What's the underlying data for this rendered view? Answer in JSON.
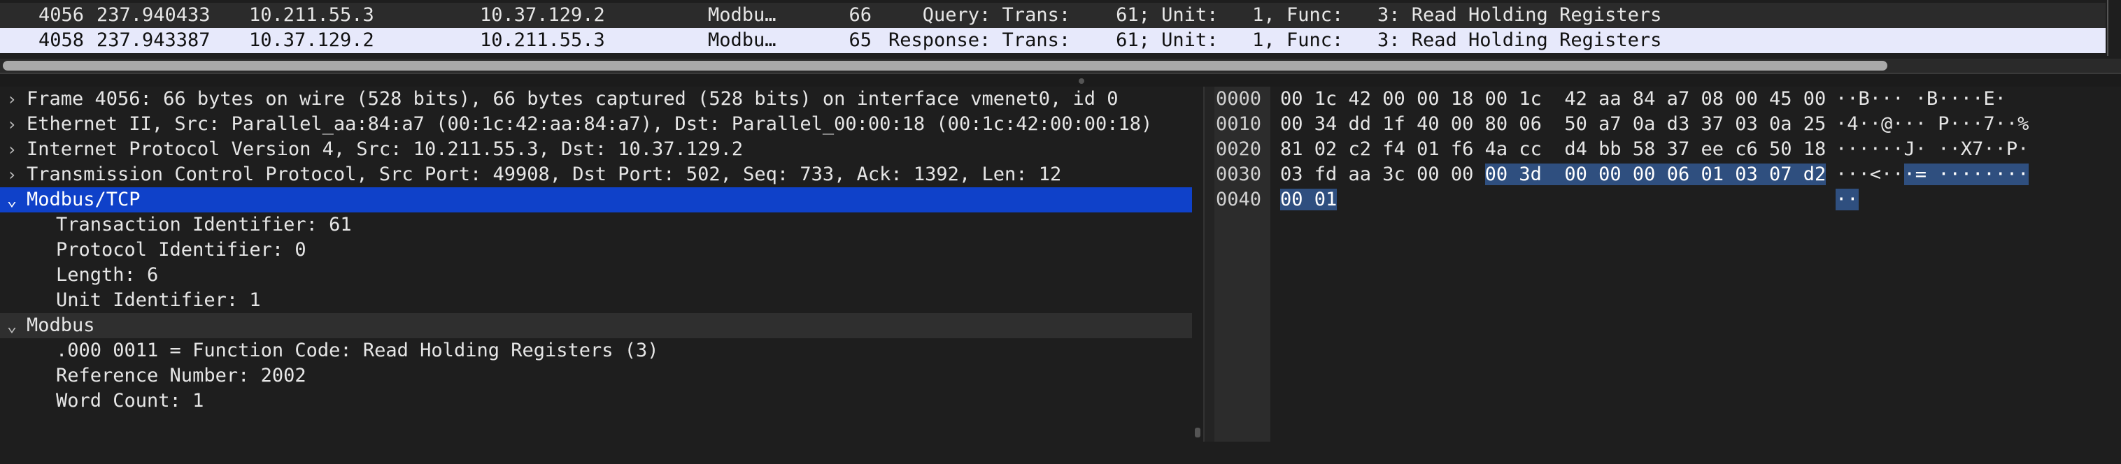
{
  "packet_list": {
    "rows": [
      {
        "no": "4056",
        "time": "237.940433",
        "source": "10.211.55.3",
        "destination": "10.37.129.2",
        "protocol": "Modbu…",
        "length": "66",
        "info": "   Query: Trans:    61; Unit:   1, Func:   3: Read Holding Registers"
      },
      {
        "no": "4058",
        "time": "237.943387",
        "source": "10.37.129.2",
        "destination": "10.211.55.3",
        "protocol": "Modbu…",
        "length": "65",
        "info": "Response: Trans:    61; Unit:   1, Func:   3: Read Holding Registers"
      }
    ]
  },
  "details": {
    "rows": [
      {
        "arrow": "›",
        "label": "Frame 4056: 66 bytes on wire (528 bits), 66 bytes captured (528 bits) on interface vmenet0, id 0"
      },
      {
        "arrow": "›",
        "label": "Ethernet II, Src: Parallel_aa:84:a7 (00:1c:42:aa:84:a7), Dst: Parallel_00:00:18 (00:1c:42:00:00:18)"
      },
      {
        "arrow": "›",
        "label": "Internet Protocol Version 4, Src: 10.211.55.3, Dst: 10.37.129.2"
      },
      {
        "arrow": "›",
        "label": "Transmission Control Protocol, Src Port: 49908, Dst Port: 502, Seq: 733, Ack: 1392, Len: 12"
      },
      {
        "arrow": "⌄",
        "label": "Modbus/TCP"
      },
      {
        "arrow": "",
        "label": "Transaction Identifier: 61"
      },
      {
        "arrow": "",
        "label": "Protocol Identifier: 0"
      },
      {
        "arrow": "",
        "label": "Length: 6"
      },
      {
        "arrow": "",
        "label": "Unit Identifier: 1"
      },
      {
        "arrow": "⌄",
        "label": "Modbus"
      },
      {
        "arrow": "",
        "label": ".000 0011 = Function Code: Read Holding Registers (3)"
      },
      {
        "arrow": "",
        "label": "Reference Number: 2002"
      },
      {
        "arrow": "",
        "label": "Word Count: 1"
      }
    ]
  },
  "bytes": {
    "rows": [
      {
        "offset": "0000",
        "hex": "00 1c 42 00 00 18 00 1c  42 aa 84 a7 08 00 45 00",
        "hex_hl": "",
        "ascii": "··B··· ·B····E·",
        "ascii_hl": ""
      },
      {
        "offset": "0010",
        "hex": "00 34 dd 1f 40 00 80 06  50 a7 0a d3 37 03 0a 25",
        "hex_hl": "",
        "ascii": "·4··@··· P···7··%",
        "ascii_hl": ""
      },
      {
        "offset": "0020",
        "hex": "81 02 c2 f4 01 f6 4a cc  d4 bb 58 37 ee c6 50 18",
        "hex_hl": "",
        "ascii": "······J· ··X7··P·",
        "ascii_hl": ""
      },
      {
        "offset": "0030",
        "hex": "03 fd aa 3c 00 00 ",
        "hex_hl": "00 3d  00 00 00 06 01 03 07 d2",
        "ascii": "···<··",
        "ascii_hl": "·= ········"
      },
      {
        "offset": "0040",
        "hex": "",
        "hex_hl": "00 01",
        "ascii": "",
        "ascii_hl": "··"
      }
    ]
  }
}
